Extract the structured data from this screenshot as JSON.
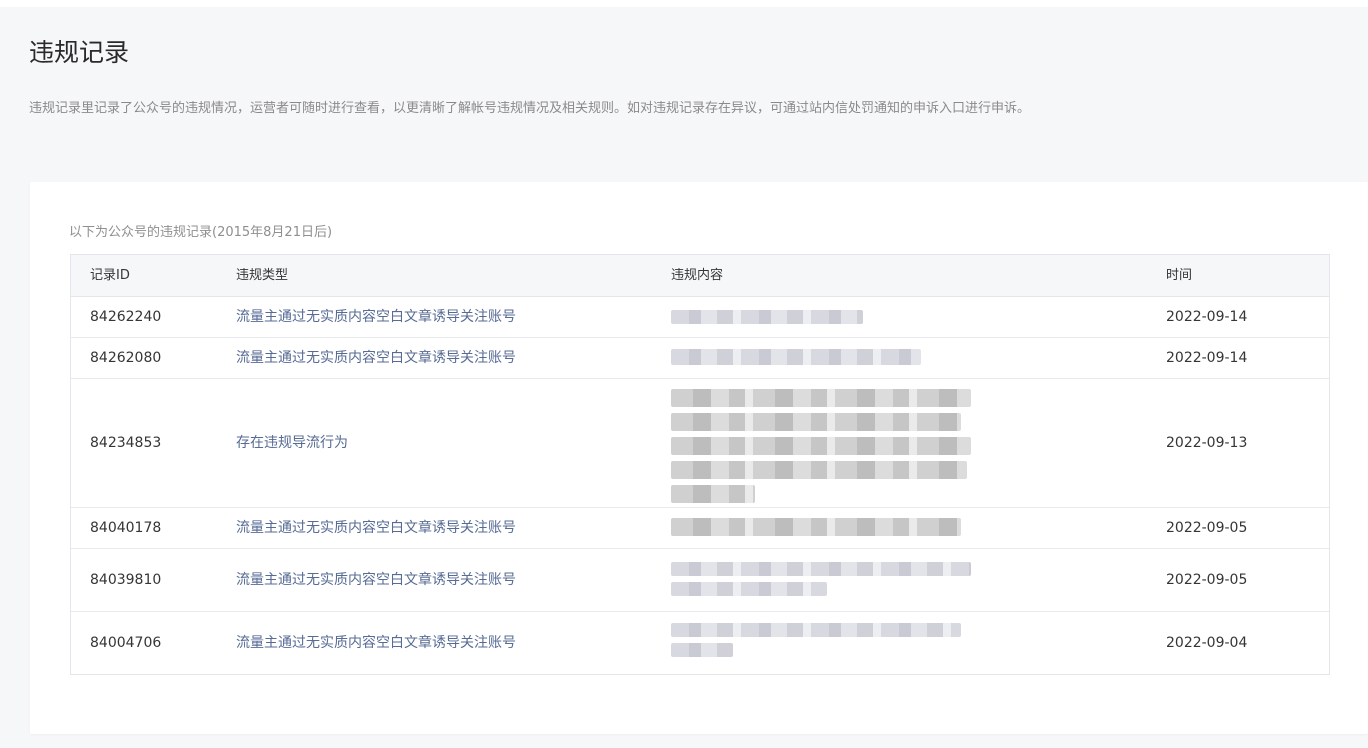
{
  "page": {
    "title": "违规记录",
    "description": "违规记录里记录了公众号的违规情况，运营者可随时进行查看，以更清晰了解帐号违规情况及相关规则。如对违规记录存在异议，可通过站内信处罚通知的申诉入口进行申诉。"
  },
  "card": {
    "caption": "以下为公众号的违规记录(2015年8月21日后)"
  },
  "table": {
    "headers": {
      "id": "记录ID",
      "type": "违规类型",
      "content": "违规内容",
      "time": "时间"
    },
    "rows": [
      {
        "id": "84262240",
        "type": "流量主通过无实质内容空白文章诱导关注账号",
        "time": "2022-09-14"
      },
      {
        "id": "84262080",
        "type": "流量主通过无实质内容空白文章诱导关注账号",
        "time": "2022-09-14"
      },
      {
        "id": "84234853",
        "type": "存在违规导流行为",
        "time": "2022-09-13"
      },
      {
        "id": "84040178",
        "type": "流量主通过无实质内容空白文章诱导关注账号",
        "time": "2022-09-05"
      },
      {
        "id": "84039810",
        "type": "流量主通过无实质内容空白文章诱导关注账号",
        "time": "2022-09-05"
      },
      {
        "id": "84004706",
        "type": "流量主通过无实质内容空白文章诱导关注账号",
        "time": "2022-09-04"
      }
    ]
  }
}
